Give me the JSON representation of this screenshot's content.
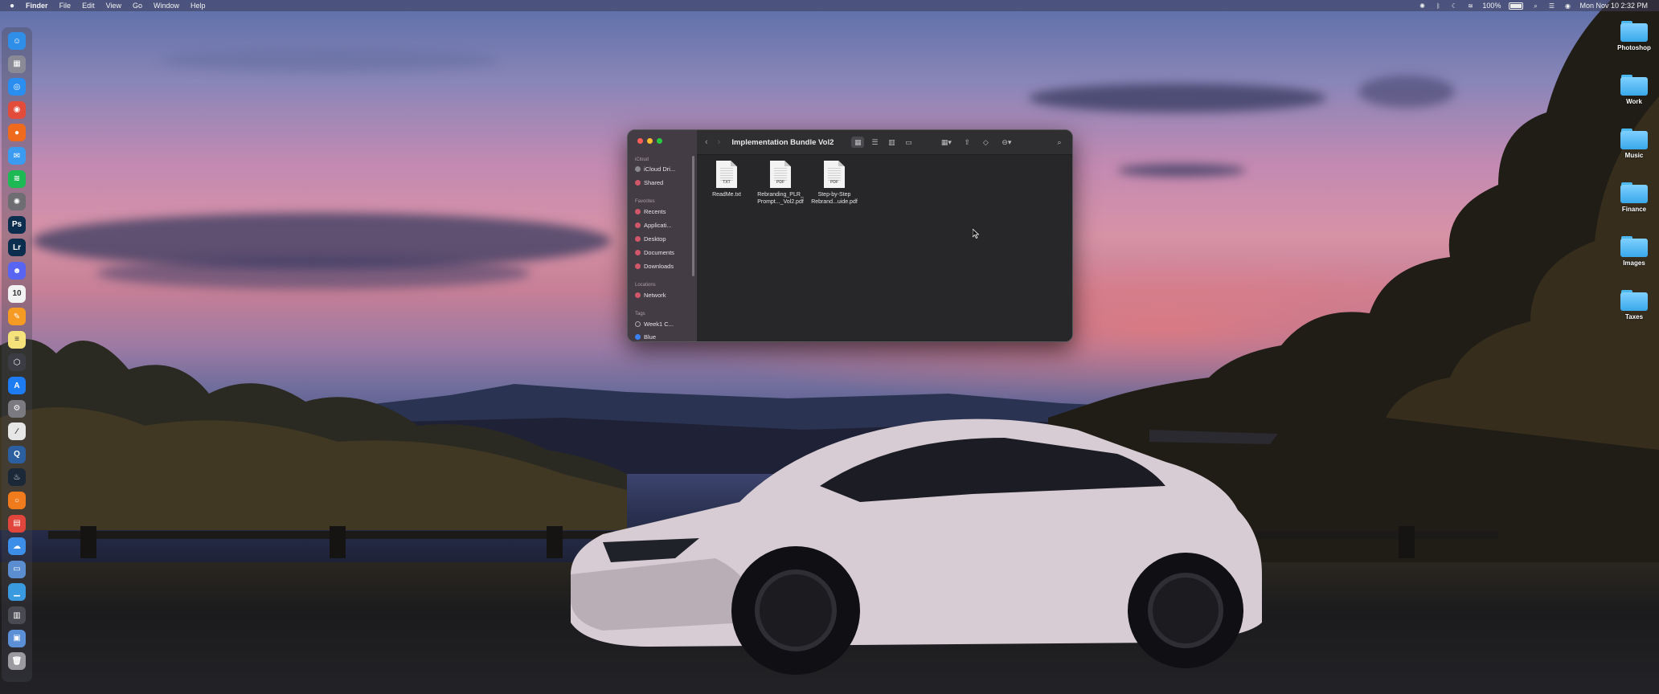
{
  "menubar": {
    "apple": "",
    "items": [
      "Finder",
      "File",
      "Edit",
      "View",
      "Go",
      "Window",
      "Help"
    ],
    "battery": "100%",
    "clock": "Mon Nov 10  2:32 PM"
  },
  "dock": {
    "icons": [
      {
        "name": "finder-icon",
        "color": "#2f8fe8",
        "glyph": "☺"
      },
      {
        "name": "launchpad-icon",
        "color": "#8a8a96",
        "glyph": "▦"
      },
      {
        "name": "safari-icon",
        "color": "#2a8df0",
        "glyph": "◎"
      },
      {
        "name": "chrome-icon",
        "color": "#e34b3b",
        "glyph": "◉"
      },
      {
        "name": "firefox-icon",
        "color": "#f06a1d",
        "glyph": "●"
      },
      {
        "name": "mail-icon",
        "color": "#3a9bf0",
        "glyph": "✉"
      },
      {
        "name": "spotify-icon",
        "color": "#1db954",
        "glyph": "≋"
      },
      {
        "name": "chatgpt-icon",
        "color": "#6d6d72",
        "glyph": "✺"
      },
      {
        "name": "photoshop-icon",
        "color": "#0b2d4e",
        "glyph": "Ps"
      },
      {
        "name": "lightroom-icon",
        "color": "#0b2d4e",
        "glyph": "Lr"
      },
      {
        "name": "discord-icon",
        "color": "#5865f2",
        "glyph": "☻"
      },
      {
        "name": "calendar-icon",
        "color": "#f2f2f2",
        "glyph": "10"
      },
      {
        "name": "pages-icon",
        "color": "#f59a23",
        "glyph": "✎"
      },
      {
        "name": "notes-icon",
        "color": "#f6e27a",
        "glyph": "≡"
      },
      {
        "name": "cube-app-icon",
        "color": "#3c3c44",
        "glyph": "⬡"
      },
      {
        "name": "app-store-icon",
        "color": "#1d7cf2",
        "glyph": "A"
      },
      {
        "name": "system-settings-icon",
        "color": "#7a7a80",
        "glyph": "⚙"
      },
      {
        "name": "script-editor-icon",
        "color": "#e6e6e6",
        "glyph": "∕"
      },
      {
        "name": "quicktime-icon",
        "color": "#2b5fa0",
        "glyph": "Q"
      },
      {
        "name": "steam-icon",
        "color": "#1b2838",
        "glyph": "♨"
      },
      {
        "name": "orange-app-icon",
        "color": "#f07b1d",
        "glyph": "○"
      },
      {
        "name": "colorful-app-icon",
        "color": "#e0463b",
        "glyph": "▤"
      },
      {
        "name": "weather-icon",
        "color": "#3c8ee8",
        "glyph": "☁"
      },
      {
        "name": "preview-icon",
        "color": "#5a8ed0",
        "glyph": "▭"
      },
      {
        "name": "downloads-folder-icon",
        "color": "#3a9ae0",
        "glyph": "▁"
      },
      {
        "name": "documents-stack-icon",
        "color": "#4a4a52",
        "glyph": "▥"
      },
      {
        "name": "screenshot-stack-icon",
        "color": "#5b8fd6",
        "glyph": "▣"
      },
      {
        "name": "trash-icon",
        "color": "#9a9aa0",
        "glyph": "🗑"
      }
    ]
  },
  "desktop": {
    "folders": [
      "Photoshop",
      "Work",
      "Music",
      "Finance",
      "Images",
      "Taxes"
    ]
  },
  "finder": {
    "title": "Implementation Bundle Vol2",
    "sidebar": {
      "icloud_header": "iCloud",
      "icloud_items": [
        "iCloud Dri...",
        "Shared"
      ],
      "favorites_header": "Favorites",
      "favorites_items": [
        "Recents",
        "Applicati...",
        "Desktop",
        "Documents",
        "Downloads"
      ],
      "locations_header": "Locations",
      "locations_items": [
        "Network"
      ],
      "tags_header": "Tags",
      "tags_items": [
        "Week1 C...",
        "Blue"
      ]
    },
    "files": [
      {
        "name_line1": "ReadMe.txt",
        "name_line2": "",
        "ext": "TXT"
      },
      {
        "name_line1": "Rebranding_PLR_",
        "name_line2": "Prompt..._Vol2.pdf",
        "ext": "PDF"
      },
      {
        "name_line1": "Step-by-Step",
        "name_line2": "Rebrand...uide.pdf",
        "ext": "PDF"
      }
    ]
  }
}
